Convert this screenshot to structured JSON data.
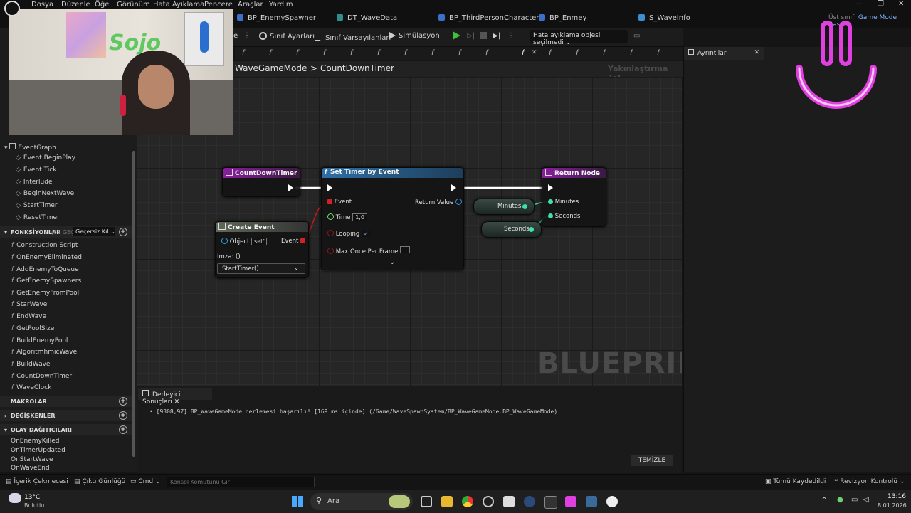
{
  "menu": [
    "Dosya",
    "Düzenle",
    "Öğe",
    "Görünüm",
    "Hata Ayıklama",
    "Pencere",
    "Araçlar",
    "Yardım"
  ],
  "tabs": [
    "BP_EnemySpawner",
    "DT_WaveData",
    "BP_ThirdPersonCharacter",
    "BP_Enmey",
    "S_WaveInfo"
  ],
  "parent_class": {
    "label": "Üst sınıf:",
    "value": "Game Mode Base"
  },
  "toolbar": {
    "class_settings": "Sınıf Ayarları",
    "class_defaults": "Sınıf Varsayılanları",
    "simulation": "Simülasyon",
    "debug_select": "Hata ayıklama objesi seçilmedi"
  },
  "details_tab": "Ayrıntılar",
  "breadcrumb": {
    "root": "_WaveGameMode",
    "separator": ">",
    "current": "CountDownTimer",
    "zoom": "Yakınlaştırma 1:1"
  },
  "graph": {
    "watermark": "BLUEPRINT",
    "node_countdown": "CountDownTimer",
    "node_settimer": "Set Timer by Event",
    "settimer_event": "Event",
    "settimer_time": "Time",
    "settimer_time_value": "1,0",
    "settimer_looping": "Looping",
    "settimer_maxonce": "Max Once Per Frame",
    "settimer_return": "Return Value",
    "node_return": "Return Node",
    "return_minutes": "Minutes",
    "return_seconds": "Seconds",
    "var_minutes": "Minutes",
    "var_seconds": "Seconds",
    "node_create": "Create Event",
    "create_object": "Object",
    "create_object_value": "self",
    "create_event": "Event",
    "create_signature": "İmza: ()",
    "create_dropdown": "StartTimer()"
  },
  "left_panel": {
    "eventgraph": "EventGraph",
    "events": [
      "Event BeginPlay",
      "Event Tick",
      "Interlude",
      "BeginNextWave",
      "StartTimer",
      "ResetTimer"
    ],
    "functions_header": "FONKSİYONLAR",
    "functions_count": "(31 GEÇE",
    "override_btn": "Geçersiz Kıl",
    "functions": [
      "Construction Script",
      "OnEnemyEliminated",
      "AddEnemyToQueue",
      "GetEnemySpawners",
      "GetEnemyFromPool",
      "StarWave",
      "EndWave",
      "GetPoolSize",
      "BuildEnemyPool",
      "AlgoritmhmicWave",
      "BuildWave",
      "CountDownTimer",
      "WaveClock"
    ],
    "macros_header": "MAKROLAR",
    "variables_header": "DEĞİŞKENLER",
    "dispatchers_header": "OLAY DAĞITICILARI",
    "dispatchers": [
      "OnEnemyKilled",
      "OnTimerUpdated",
      "OnStartWave",
      "OnWaveEnd"
    ]
  },
  "compiler": {
    "tab": "Derleyici Sonuçları",
    "message": "[9308,97] BP_WaveGameMode derlemesi başarılı! [169 ms içinde] (/Game/WaveSpawnSystem/BP_WaveGameMode.BP_WaveGameMode)",
    "clear": "TEMİZLE"
  },
  "statusbar": {
    "content_drawer": "İçerik Çekmecesi",
    "output_log": "Çıktı Günlüğü",
    "cmd": "Cmd",
    "console_placeholder": "Konsol Komutunu Gir",
    "save_all": "Tümü Kaydedildi",
    "revision": "Revizyon Kontrolü"
  },
  "taskbar": {
    "weather_temp": "13°C",
    "weather_desc": "Bulutlu",
    "search": "Ara",
    "time": "13:16",
    "date": "8.01.2026"
  },
  "colors": {
    "accent_pink": "#e040e0",
    "event_red": "#c01818",
    "function_blue": "#2e6fa6",
    "return_purple": "#8a1fa0"
  }
}
